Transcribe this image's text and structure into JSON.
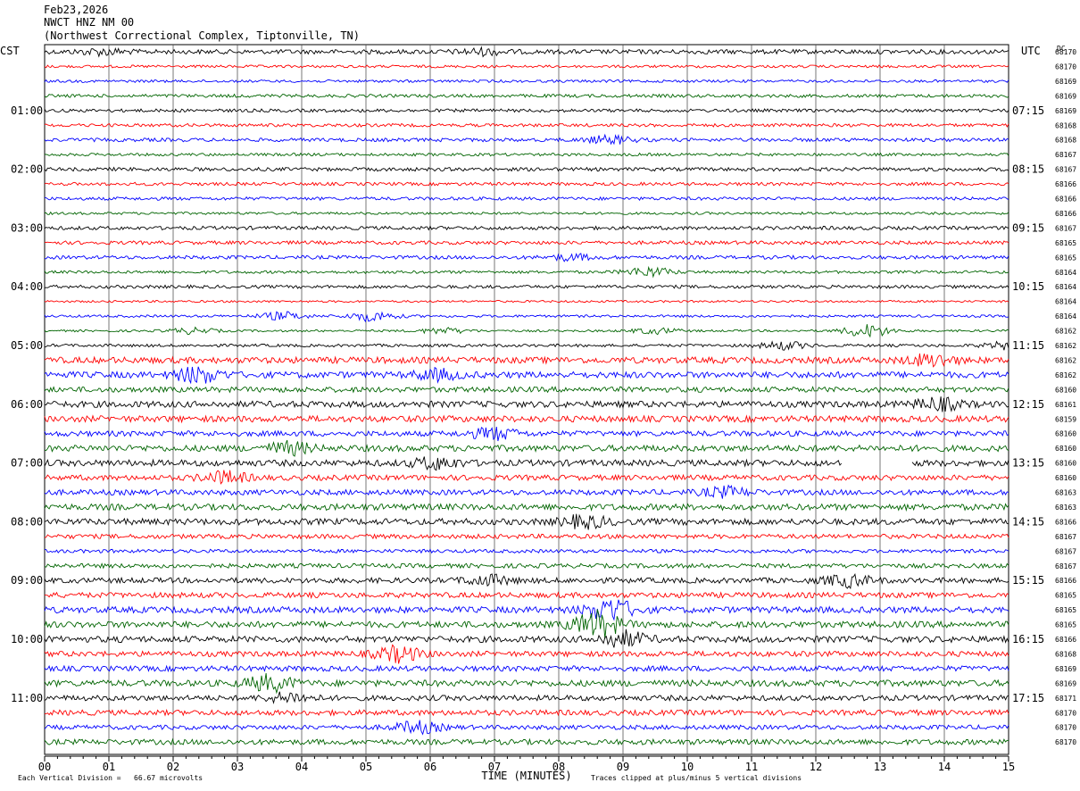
{
  "header": {
    "date": "Feb23,2026",
    "station": "NWCT HNZ NM 00",
    "location": "(Northwest Correctional Complex, Tiptonville, TN)"
  },
  "left_tz": "CST",
  "right_tz": "UTC",
  "dc_label": "DC",
  "footer": {
    "scale_note": "Each Vertical Division =   66.67 microvolts",
    "clip_note": "Traces clipped at plus/minus 5 vertical divisions"
  },
  "chart_data": {
    "type": "line",
    "title": "",
    "xlabel": "TIME (MINUTES)",
    "ylabel": "",
    "xlim": [
      0,
      15
    ],
    "x_ticks": [
      "00",
      "01",
      "02",
      "03",
      "04",
      "05",
      "06",
      "07",
      "08",
      "09",
      "10",
      "11",
      "12",
      "13",
      "14",
      "15"
    ],
    "grid": true,
    "trace_colors": [
      "#000000",
      "#ff0000",
      "#0000ff",
      "#006400"
    ],
    "left_hour_labels": [
      "01:00",
      "02:00",
      "03:00",
      "04:00",
      "05:00",
      "06:00",
      "07:00",
      "08:00",
      "09:00",
      "10:00",
      "11:00"
    ],
    "right_hour_labels": [
      "07:15",
      "08:15",
      "09:15",
      "10:15",
      "11:15",
      "12:15",
      "13:15",
      "14:15",
      "15:15",
      "16:15",
      "17:15"
    ],
    "dc_values": [
      "68170",
      "68170",
      "68169",
      "68169",
      "68169",
      "68168",
      "68168",
      "68167",
      "68167",
      "68166",
      "68166",
      "68166",
      "68167",
      "68165",
      "68165",
      "68164",
      "68164",
      "68164",
      "68164",
      "68162",
      "68162",
      "68162",
      "68162",
      "68160",
      "68161",
      "68159",
      "68160",
      "68160",
      "68160",
      "68160",
      "68163",
      "68163",
      "68166",
      "68167",
      "68167",
      "68167",
      "68166",
      "68165",
      "68165",
      "68165",
      "68166",
      "68168",
      "68169",
      "68169",
      "68171",
      "68170",
      "68170",
      "68170"
    ],
    "trace_amplitudes": [
      2.5,
      1.5,
      1.5,
      1.8,
      1.8,
      1.8,
      2,
      1.6,
      2,
      1.8,
      1.8,
      1.4,
      2,
      2,
      2,
      1.6,
      1.8,
      1.2,
      1.4,
      1.2,
      1.6,
      3.5,
      3.5,
      3,
      3.5,
      3.5,
      3,
      3.5,
      3.5,
      3,
      3,
      3.5,
      3.5,
      2.5,
      2,
      2.5,
      3,
      3,
      3.5,
      3.5,
      3.5,
      3,
      3,
      3.5,
      3,
      3,
      2.5,
      3
    ],
    "events": [
      {
        "trace": 0,
        "x": 0.9,
        "amp": 3
      },
      {
        "trace": 0,
        "x": 6.8,
        "amp": 3
      },
      {
        "trace": 6,
        "x": 8.8,
        "amp": 4
      },
      {
        "trace": 14,
        "x": 8.2,
        "amp": 3
      },
      {
        "trace": 15,
        "x": 9.4,
        "amp": 5
      },
      {
        "trace": 18,
        "x": 3.7,
        "amp": 4
      },
      {
        "trace": 18,
        "x": 5.1,
        "amp": 5
      },
      {
        "trace": 19,
        "x": 2.3,
        "amp": 3
      },
      {
        "trace": 19,
        "x": 6.2,
        "amp": 3
      },
      {
        "trace": 19,
        "x": 9.5,
        "amp": 3
      },
      {
        "trace": 19,
        "x": 12.8,
        "amp": 7
      },
      {
        "trace": 20,
        "x": 11.5,
        "amp": 4
      },
      {
        "trace": 20,
        "x": 15.0,
        "amp": 4
      },
      {
        "trace": 21,
        "x": 13.8,
        "amp": 6
      },
      {
        "trace": 22,
        "x": 2.4,
        "amp": 8
      },
      {
        "trace": 22,
        "x": 6.1,
        "amp": 5
      },
      {
        "trace": 24,
        "x": 13.9,
        "amp": 6
      },
      {
        "trace": 26,
        "x": 7.0,
        "amp": 6
      },
      {
        "trace": 27,
        "x": 3.8,
        "amp": 6
      },
      {
        "trace": 28,
        "x": 6.1,
        "amp": 6
      },
      {
        "trace": 29,
        "x": 2.8,
        "amp": 6
      },
      {
        "trace": 30,
        "x": 10.6,
        "amp": 5
      },
      {
        "trace": 32,
        "x": 8.4,
        "amp": 6
      },
      {
        "trace": 36,
        "x": 6.9,
        "amp": 5
      },
      {
        "trace": 36,
        "x": 12.5,
        "amp": 6
      },
      {
        "trace": 38,
        "x": 8.8,
        "amp": 12
      },
      {
        "trace": 39,
        "x": 8.6,
        "amp": 14
      },
      {
        "trace": 40,
        "x": 9.0,
        "amp": 8
      },
      {
        "trace": 41,
        "x": 5.5,
        "amp": 8
      },
      {
        "trace": 43,
        "x": 3.5,
        "amp": 8
      },
      {
        "trace": 44,
        "x": 3.8,
        "amp": 5
      },
      {
        "trace": 46,
        "x": 5.8,
        "amp": 6
      }
    ],
    "gaps": [
      {
        "trace": 28,
        "from": 12.4,
        "to": 13.1
      },
      {
        "trace": 28,
        "from": 13.1,
        "to": 13.5
      }
    ]
  }
}
